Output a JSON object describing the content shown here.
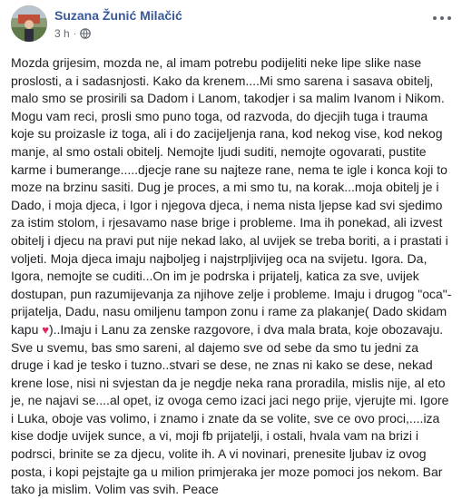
{
  "post": {
    "author": "Suzana Žunić Milačić",
    "time": "3 h",
    "separator": "·",
    "privacy_icon": "globe-icon",
    "menu_icon": "more-options-icon",
    "text_before_heart": "Mozda grijesim, mozda ne, al imam potrebu podijeliti neke lipe slike nase proslosti, a i sadasnjosti. Kako da krenem....Mi smo sarena i sasava obitelj, malo smo se prosirili sa Dadom i Lanom, takodjer i sa malim Ivanom i Nikom. Mogu vam reci, prosli smo puno toga, od razvoda, do djecjih tuga i trauma koje su proizasle iz toga, ali i do zacijeljenja rana, kod nekog vise, kod nekog manje, al smo ostali obitelj. Nemojte ljudi suditi, nemojte ogovarati, pustite karme i bumerange.....djecje rane su najteze rane, nema te igle i konca koji to moze na brzinu sasiti. Dug je proces, a mi smo tu, na korak...moja obitelj je i Dado, i moja djeca, i Igor i njegova djeca, i nema nista ljepse kad svi sjedimo za istim stolom, i rjesavamo nase brige i probleme. Ima ih ponekad, ali izvest obitelj i djecu na pravi put nije nekad lako, al uvijek se treba boriti, a i prastati i voljeti. Moja djeca imaju najboljeg i najstrpljivijeg oca na svijetu. Igora. Da, Igora, nemojte se cuditi...On im je podrska i prijatelj, katica za sve, uvijek dostupan, pun razumijevanja za njihove zelje i probleme. Imaju i drugog \"oca\"-prijatelja, Dadu, nasu omiljenu tampon zonu i rame za plakanje( Dado skidam kapu ",
    "heart": "♥",
    "text_after_heart": ")..Imaju i Lanu za zenske razgovore, i dva mala brata, koje obozavaju. Sve u svemu, bas smo sareni, al dajemo sve od sebe da smo tu jedni za druge i kad je tesko i tuzno..stvari se dese, ne znas ni kako se dese, nekad krene lose, nisi ni svjestan da je negdje neka rana proradila, mislis nije, al eto je, ne najavi se....al opet, iz ovoga cemo izaci jaci nego prije, vjerujte mi. Igore i Luka, oboje vas volimo, i znamo i znate da se volite, sve ce ovo proci,....iza kise dodje uvijek sunce, a vi, moji fb prijatelji, i ostali, hvala vam na brizi i podrsci, brinite se za djecu, volite ih. A vi novinari, prenesite ljubav iz ovog posta, i kopi pejstajte ga u milion primjeraka jer moze pomoci jos nekom. Bar tako ja mislim. Volim vas svih. Peace"
  },
  "colors": {
    "author_link": "#385898",
    "text": "#1c1e21",
    "meta": "#616770",
    "heart": "#e0245e"
  }
}
